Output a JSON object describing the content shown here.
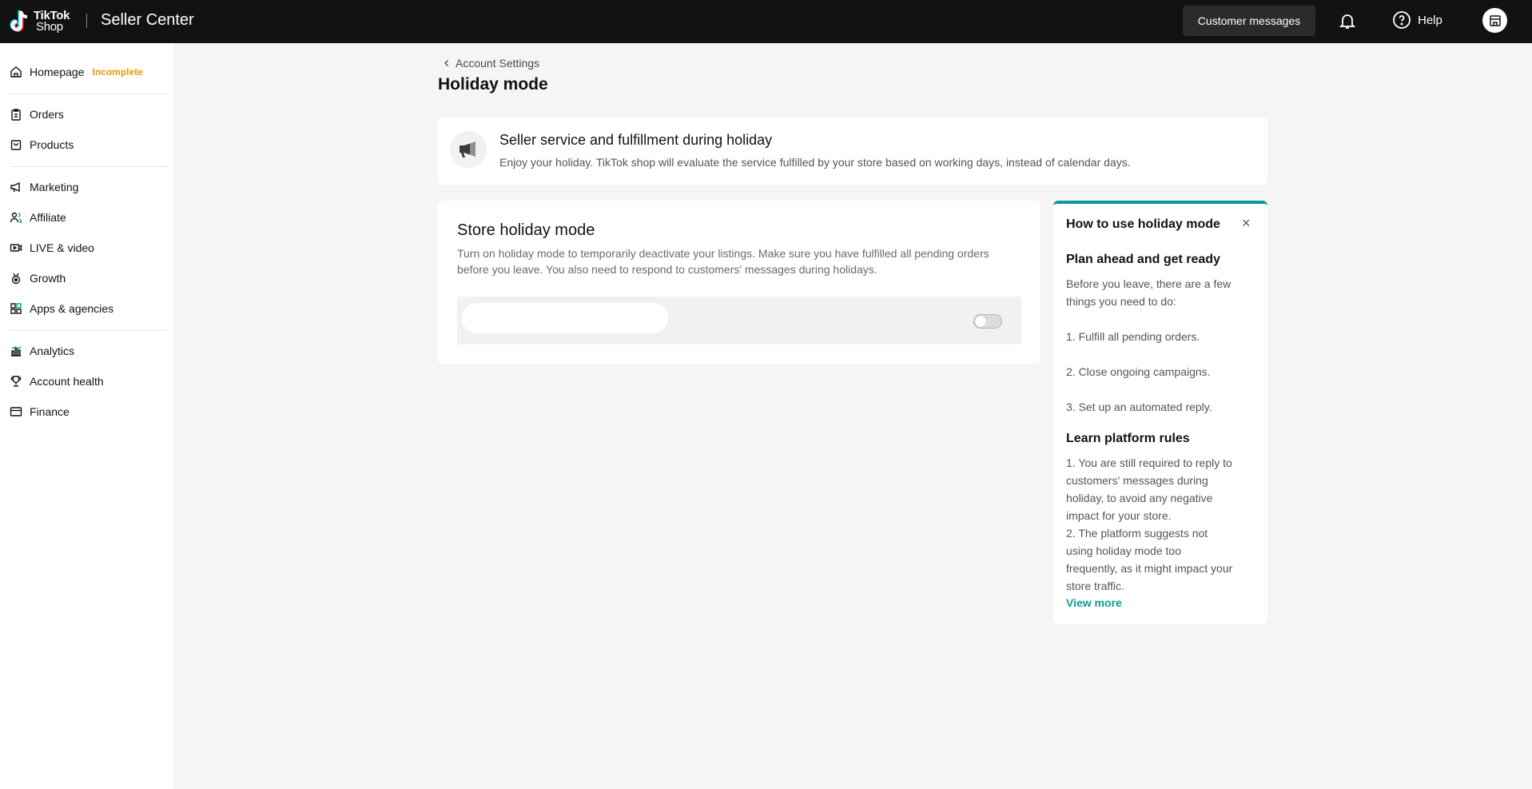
{
  "topbar": {
    "logo_line1": "TikTok",
    "logo_line2": "Shop",
    "app_title": "Seller Center",
    "messages_label": "Customer messages",
    "help_label": "Help"
  },
  "sidebar": {
    "items": [
      {
        "label": "Homepage",
        "icon": "home-icon"
      },
      {
        "label": "Orders",
        "icon": "clipboard-icon"
      },
      {
        "label": "Products",
        "icon": "box-icon"
      },
      {
        "label": "Marketing",
        "icon": "megaphone-icon"
      },
      {
        "label": "Affiliate",
        "icon": "users-icon"
      },
      {
        "label": "LIVE & video",
        "icon": "video-icon"
      },
      {
        "label": "Growth",
        "icon": "medal-icon"
      },
      {
        "label": "Apps & agencies",
        "icon": "grid-icon"
      },
      {
        "label": "Analytics",
        "icon": "bar-chart-icon"
      },
      {
        "label": "Account health",
        "icon": "trophy-icon"
      },
      {
        "label": "Finance",
        "icon": "wallet-icon"
      }
    ],
    "homepage_badge": "Incomplete"
  },
  "breadcrumb": {
    "back_label": "Account Settings"
  },
  "page": {
    "title": "Holiday mode"
  },
  "banner": {
    "title": "Seller service and fulfillment during holiday",
    "description": "Enjoy your holiday. TikTok shop will evaluate the service fulfilled by your store based on working days, instead of calendar days."
  },
  "holiday_card": {
    "title": "Store holiday mode",
    "description": "Turn on holiday mode to temporarily deactivate your listings. Make sure you have fulfilled all pending orders before you leave. You also need to respond to customers' messages during holidays.",
    "toggle_on": false
  },
  "help_panel": {
    "title": "How to use holiday mode",
    "section1_title": "Plan ahead and get ready",
    "section1_intro": "Before you leave, there are a few things you need to do:",
    "step1": "1. Fulfill all pending orders.",
    "step2": "2. Close ongoing campaigns.",
    "step3": "3. Set up an automated reply.",
    "section2_title": "Learn platform rules",
    "rule1": "1. You are still required to reply to customers' messages during holiday, to avoid any negative impact for your store.",
    "rule2": "2. The platform suggests not using holiday mode too frequently, as it might impact your store traffic.",
    "view_more": "View more"
  },
  "colors": {
    "accent": "#0a9b94",
    "badge": "#e89b00",
    "topbar": "#121212"
  }
}
